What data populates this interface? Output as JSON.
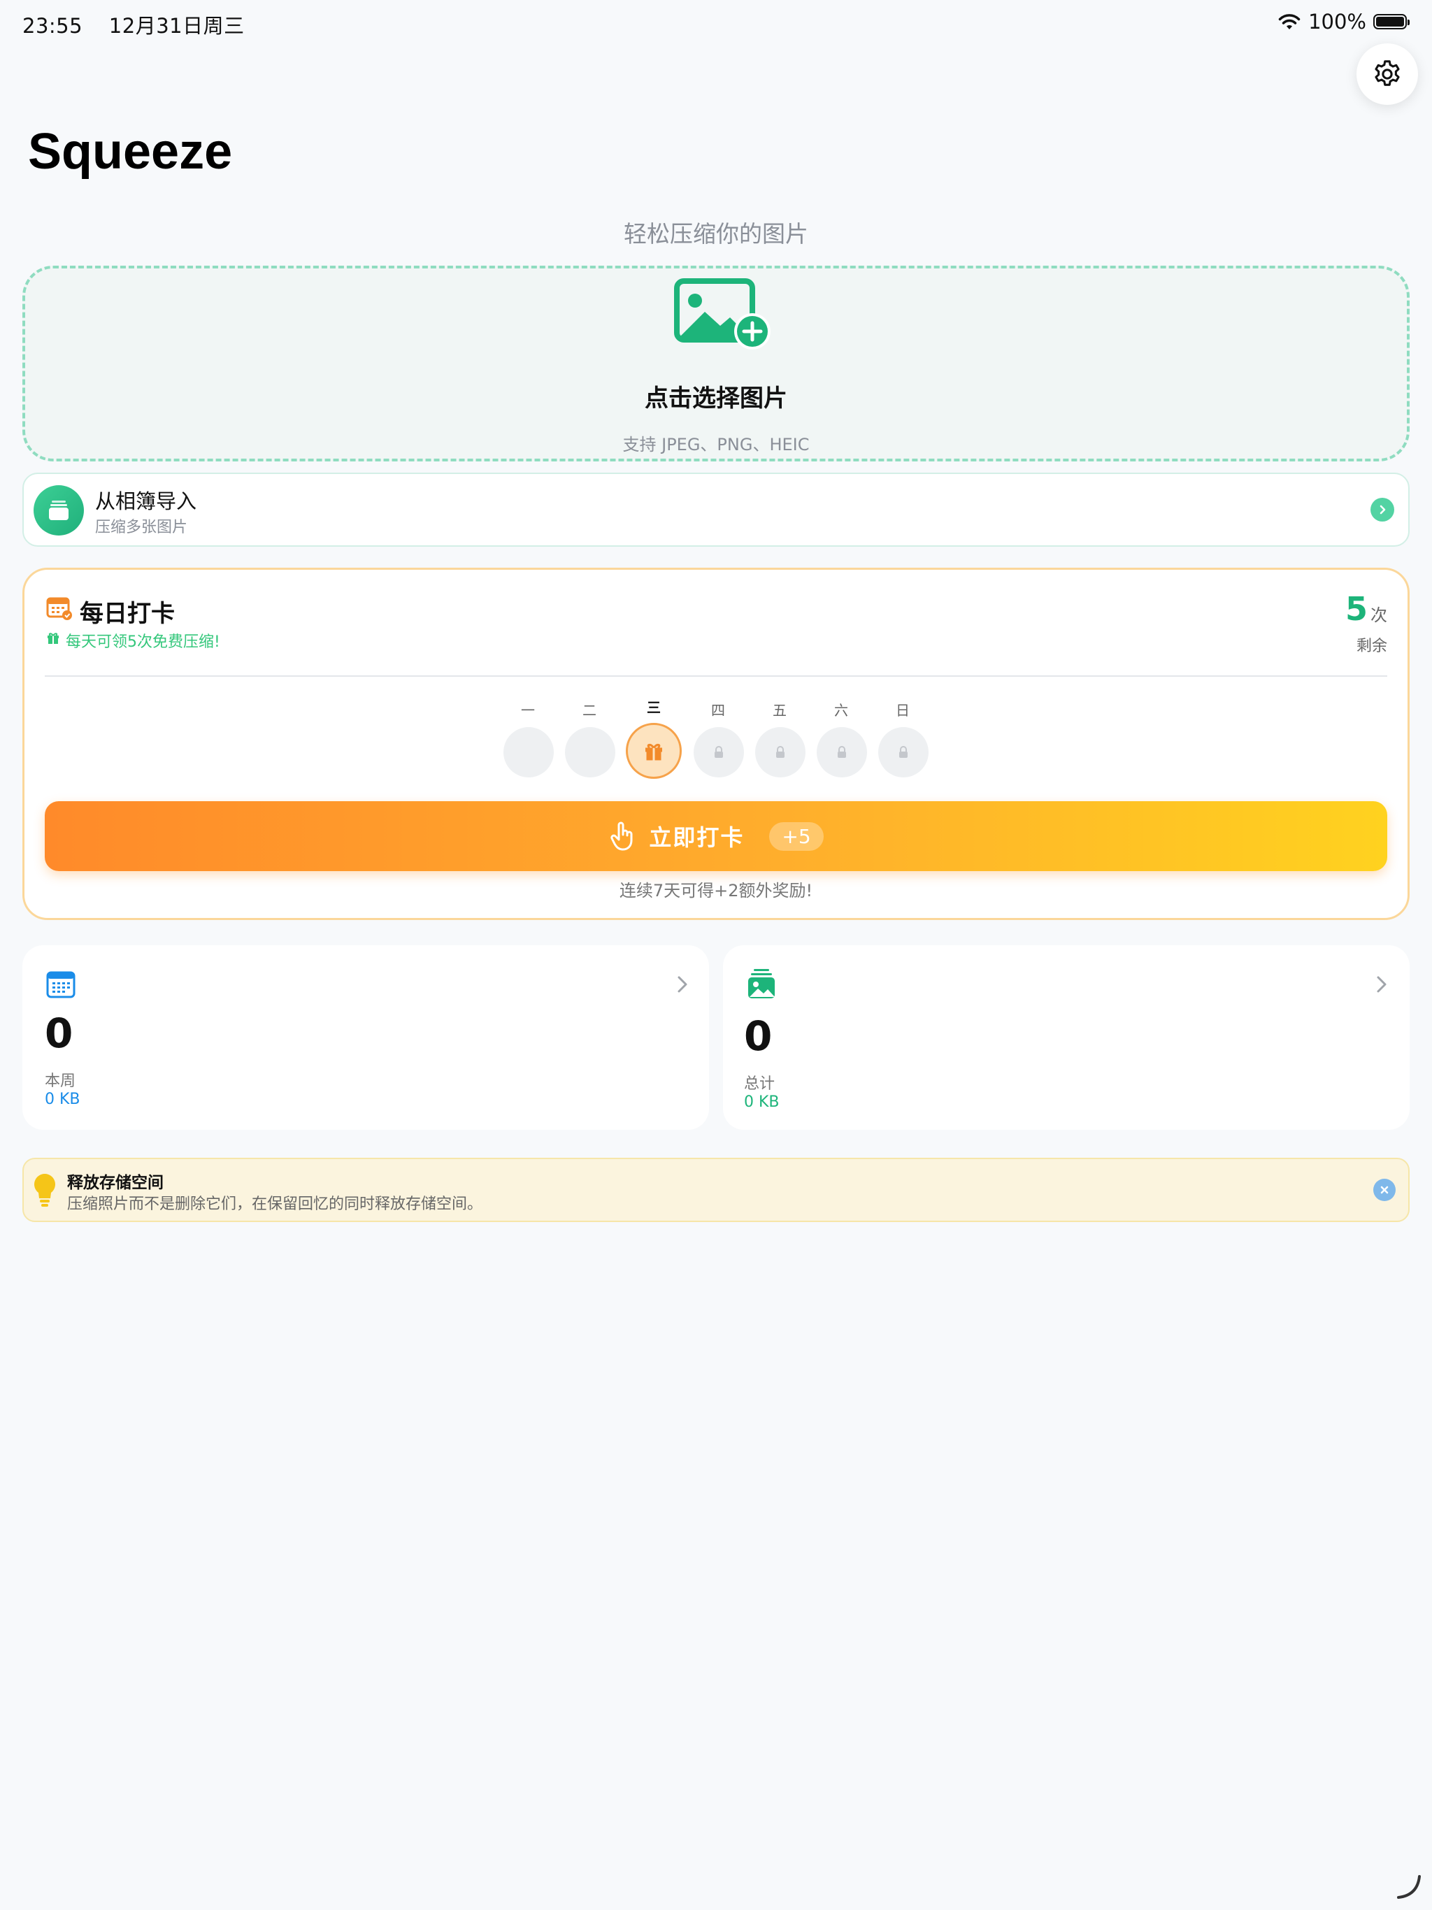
{
  "status_bar": {
    "time": "23:55",
    "date": "12月31日周三",
    "battery": "100%"
  },
  "app": {
    "title": "Squeeze",
    "subtitle": "轻松压缩你的图片"
  },
  "picker": {
    "title": "点击选择图片",
    "formats": "支持 JPEG、PNG、HEIC",
    "icon": "image-add-icon"
  },
  "album_import": {
    "title": "从相簿导入",
    "subtitle": "压缩多张图片"
  },
  "checkin": {
    "title": "每日打卡",
    "hint": "每天可领5次免费压缩!",
    "count": "5",
    "count_unit": "次",
    "remaining_label": "剩余",
    "days": [
      {
        "label": "一",
        "state": "past"
      },
      {
        "label": "二",
        "state": "past"
      },
      {
        "label": "三",
        "state": "today"
      },
      {
        "label": "四",
        "state": "locked"
      },
      {
        "label": "五",
        "state": "locked"
      },
      {
        "label": "六",
        "state": "locked"
      },
      {
        "label": "日",
        "state": "locked"
      }
    ],
    "button_label": "立即打卡",
    "button_badge": "+5",
    "bonus_text": "连续7天可得+2额外奖励!"
  },
  "stats": [
    {
      "value": "0",
      "label": "本周",
      "size": "0 KB",
      "accent": "#1a8ce8"
    },
    {
      "value": "0",
      "label": "总计",
      "size": "0 KB",
      "accent": "#1db47a"
    }
  ],
  "tip": {
    "title": "释放存储空间",
    "text": "压缩照片而不是删除它们，在保留回忆的同时释放存储空间。"
  },
  "colors": {
    "brand_green": "#1db47a",
    "orange": "#ff8a2a",
    "blue": "#1a8ce8"
  }
}
